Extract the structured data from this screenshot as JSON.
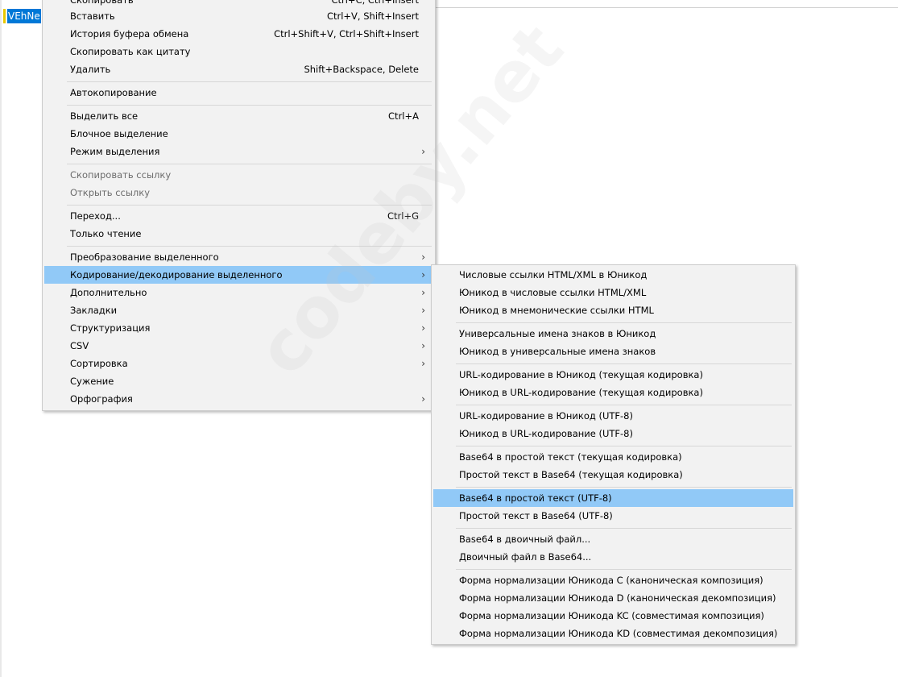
{
  "editor": {
    "selected_text": "VEhNe"
  },
  "main_menu": {
    "items": [
      {
        "label": "Скопировать",
        "shortcut": "Ctrl+C, Ctrl+Insert"
      },
      {
        "label": "Вставить",
        "shortcut": "Ctrl+V, Shift+Insert"
      },
      {
        "label": "История буфера обмена",
        "shortcut": "Ctrl+Shift+V, Ctrl+Shift+Insert"
      },
      {
        "label": "Скопировать как цитату",
        "shortcut": ""
      },
      {
        "label": "Удалить",
        "shortcut": "Shift+Backspace, Delete"
      },
      {
        "label": "Автокопирование",
        "shortcut": ""
      },
      {
        "label": "Выделить все",
        "shortcut": "Ctrl+A"
      },
      {
        "label": "Блочное выделение",
        "shortcut": ""
      },
      {
        "label": "Режим выделения",
        "shortcut": ""
      },
      {
        "label": "Скопировать ссылку",
        "shortcut": ""
      },
      {
        "label": "Открыть ссылку",
        "shortcut": ""
      },
      {
        "label": "Переход...",
        "shortcut": "Ctrl+G"
      },
      {
        "label": "Только чтение",
        "shortcut": ""
      },
      {
        "label": "Преобразование выделенного",
        "shortcut": ""
      },
      {
        "label": "Кодирование/декодирование выделенного",
        "shortcut": ""
      },
      {
        "label": "Дополнительно",
        "shortcut": ""
      },
      {
        "label": "Закладки",
        "shortcut": ""
      },
      {
        "label": "Структуризация",
        "shortcut": ""
      },
      {
        "label": "CSV",
        "shortcut": ""
      },
      {
        "label": "Сортировка",
        "shortcut": ""
      },
      {
        "label": "Сужение",
        "shortcut": ""
      },
      {
        "label": "Орфография",
        "shortcut": ""
      }
    ],
    "highlighted": "Кодирование/декодирование выделенного"
  },
  "sub_menu": {
    "items": [
      {
        "label": "Числовые ссылки HTML/XML в Юникод"
      },
      {
        "label": "Юникод в числовые ссылки HTML/XML"
      },
      {
        "label": "Юникод в мнемонические ссылки HTML"
      },
      {
        "label": "Универсальные имена знаков в Юникод"
      },
      {
        "label": "Юникод в универсальные имена знаков"
      },
      {
        "label": "URL-кодирование в Юникод (текущая кодировка)"
      },
      {
        "label": "Юникод в URL-кодирование (текущая кодировка)"
      },
      {
        "label": "URL-кодирование в Юникод (UTF-8)"
      },
      {
        "label": "Юникод в URL-кодирование (UTF-8)"
      },
      {
        "label": "Base64 в простой текст (текущая кодировка)"
      },
      {
        "label": "Простой текст в Base64 (текущая кодировка)"
      },
      {
        "label": "Base64 в простой текст (UTF-8)"
      },
      {
        "label": "Простой текст в Base64 (UTF-8)"
      },
      {
        "label": "Base64 в двоичный файл..."
      },
      {
        "label": "Двоичный файл в Base64..."
      },
      {
        "label": "Форма нормализации Юникода C (каноническая композиция)"
      },
      {
        "label": "Форма нормализации Юникода D (каноническая декомпозиция)"
      },
      {
        "label": "Форма нормализации Юникода KC (совместимая композиция)"
      },
      {
        "label": "Форма нормализации Юникода KD (совместимая декомпозиция)"
      }
    ],
    "highlighted": "Base64 в простой текст (UTF-8)"
  },
  "watermark": {
    "text": "codeby.net"
  },
  "colors": {
    "menu_bg": "#f2f2f2",
    "highlight": "#91c9f7",
    "selection": "#0078d7",
    "disabled_text": "#6d6d6d"
  }
}
